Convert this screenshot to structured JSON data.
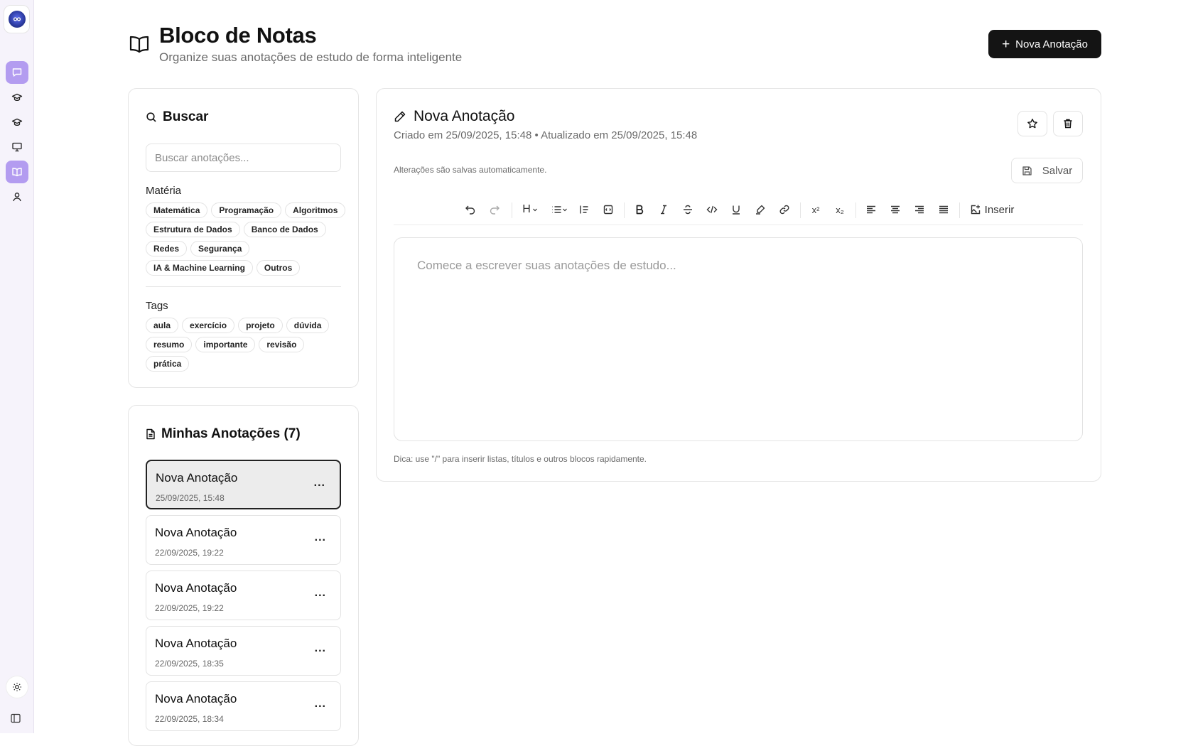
{
  "header": {
    "title": "Bloco de Notas",
    "subtitle": "Organize suas anotações de estudo de forma inteligente",
    "new_button_label": "Nova Anotação"
  },
  "search": {
    "title": "Buscar",
    "placeholder": "Buscar anotações...",
    "subject_label": "Matéria",
    "subjects": [
      "Matemática",
      "Programação",
      "Algoritmos",
      "Estrutura de Dados",
      "Banco de Dados",
      "Redes",
      "Segurança",
      "IA & Machine Learning",
      "Outros"
    ],
    "tags_label": "Tags",
    "tags": [
      "aula",
      "exercício",
      "projeto",
      "dúvida",
      "resumo",
      "importante",
      "revisão",
      "prática"
    ]
  },
  "notes": {
    "title": "Minhas Anotações (7)",
    "items": [
      {
        "title": "Nova Anotação",
        "date": "25/09/2025, 15:48",
        "more": "...",
        "selected": true
      },
      {
        "title": "Nova Anotação",
        "date": "22/09/2025, 19:22",
        "more": "..."
      },
      {
        "title": "Nova Anotação",
        "date": "22/09/2025, 19:22",
        "more": "..."
      },
      {
        "title": "Nova Anotação",
        "date": "22/09/2025, 18:35",
        "more": "..."
      },
      {
        "title": "Nova Anotação",
        "date": "22/09/2025, 18:34",
        "more": "..."
      }
    ]
  },
  "editor": {
    "title": "Nova Anotação",
    "meta": "Criado em 25/09/2025, 15:48 • Atualizado em 25/09/2025, 15:48",
    "autosave_text": "Alterações são salvas automaticamente.",
    "save_label": "Salvar",
    "heading_label": "H",
    "insert_label": "Inserir",
    "superscript_label": "x²",
    "subscript_label": "x₂",
    "placeholder": "Comece a escrever suas anotações de estudo...",
    "hint": "Dica: use \"/\" para inserir listas, títulos e outros blocos rapidamente."
  },
  "colors": {
    "accent": "#b39cf0",
    "primary_button": "#141414",
    "rail_background": "#f6f3fb"
  },
  "icons": {
    "rail": [
      "chat-icon",
      "graduation-cap-icon",
      "graduation-cap-icon",
      "presentation-icon",
      "book-open-icon",
      "user-icon"
    ],
    "active_rail_items": [
      "chat-icon",
      "book-open-icon"
    ]
  }
}
